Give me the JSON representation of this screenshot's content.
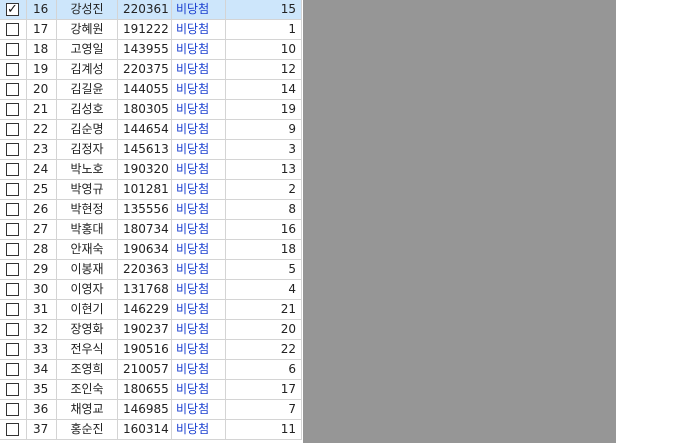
{
  "rows": [
    {
      "no": "16",
      "name": "강성진",
      "id": "220361",
      "status": "비당첨",
      "count": "15",
      "checked": true
    },
    {
      "no": "17",
      "name": "강혜원",
      "id": "191222",
      "status": "비당첨",
      "count": "1",
      "checked": false
    },
    {
      "no": "18",
      "name": "고영일",
      "id": "143955",
      "status": "비당첨",
      "count": "10",
      "checked": false
    },
    {
      "no": "19",
      "name": "김계성",
      "id": "220375",
      "status": "비당첨",
      "count": "12",
      "checked": false
    },
    {
      "no": "20",
      "name": "김길윤",
      "id": "144055",
      "status": "비당첨",
      "count": "14",
      "checked": false
    },
    {
      "no": "21",
      "name": "김성호",
      "id": "180305",
      "status": "비당첨",
      "count": "19",
      "checked": false
    },
    {
      "no": "22",
      "name": "김순명",
      "id": "144654",
      "status": "비당첨",
      "count": "9",
      "checked": false
    },
    {
      "no": "23",
      "name": "김정자",
      "id": "145613",
      "status": "비당첨",
      "count": "3",
      "checked": false
    },
    {
      "no": "24",
      "name": "박노호",
      "id": "190320",
      "status": "비당첨",
      "count": "13",
      "checked": false
    },
    {
      "no": "25",
      "name": "박영규",
      "id": "101281",
      "status": "비당첨",
      "count": "2",
      "checked": false
    },
    {
      "no": "26",
      "name": "박현정",
      "id": "135556",
      "status": "비당첨",
      "count": "8",
      "checked": false
    },
    {
      "no": "27",
      "name": "박홍대",
      "id": "180734",
      "status": "비당첨",
      "count": "16",
      "checked": false
    },
    {
      "no": "28",
      "name": "안재숙",
      "id": "190634",
      "status": "비당첨",
      "count": "18",
      "checked": false
    },
    {
      "no": "29",
      "name": "이봉재",
      "id": "220363",
      "status": "비당첨",
      "count": "5",
      "checked": false
    },
    {
      "no": "30",
      "name": "이영자",
      "id": "131768",
      "status": "비당첨",
      "count": "4",
      "checked": false
    },
    {
      "no": "31",
      "name": "이현기",
      "id": "146229",
      "status": "비당첨",
      "count": "21",
      "checked": false
    },
    {
      "no": "32",
      "name": "장영화",
      "id": "190237",
      "status": "비당첨",
      "count": "20",
      "checked": false
    },
    {
      "no": "33",
      "name": "전우식",
      "id": "190516",
      "status": "비당첨",
      "count": "22",
      "checked": false
    },
    {
      "no": "34",
      "name": "조영희",
      "id": "210057",
      "status": "비당첨",
      "count": "6",
      "checked": false
    },
    {
      "no": "35",
      "name": "조인숙",
      "id": "180655",
      "status": "비당첨",
      "count": "17",
      "checked": false
    },
    {
      "no": "36",
      "name": "채영교",
      "id": "146985",
      "status": "비당첨",
      "count": "7",
      "checked": false
    },
    {
      "no": "37",
      "name": "홍순진",
      "id": "160314",
      "status": "비당첨",
      "count": "11",
      "checked": false
    }
  ],
  "colors": {
    "status_text": "#1a3fd0",
    "selected_row": "#cde6fb",
    "panel": "#969696"
  }
}
